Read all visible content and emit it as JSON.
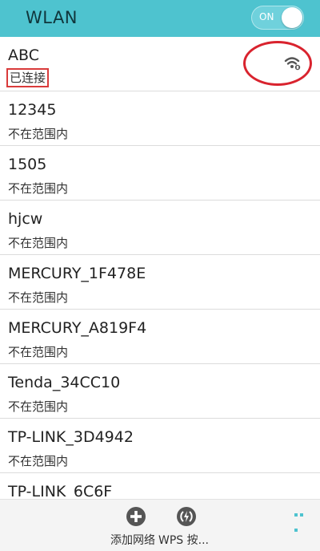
{
  "header": {
    "title": "WLAN",
    "toggle_label": "ON"
  },
  "networks": [
    {
      "ssid": "ABC",
      "status": "已连接"
    },
    {
      "ssid": "12345",
      "status": "不在范围内"
    },
    {
      "ssid": "1505",
      "status": "不在范围内"
    },
    {
      "ssid": "hjcw",
      "status": "不在范围内"
    },
    {
      "ssid": "MERCURY_1F478E",
      "status": "不在范围内"
    },
    {
      "ssid": "MERCURY_A819F4",
      "status": "不在范围内"
    },
    {
      "ssid": "Tenda_34CC10",
      "status": "不在范围内"
    },
    {
      "ssid": "TP-LINK_3D4942",
      "status": "不在范围内"
    },
    {
      "ssid": "TP-LINK_6C6F",
      "status": ""
    }
  ],
  "bottom": {
    "add_label": "添加网络",
    "wps_label": "WPS 按..."
  },
  "colors": {
    "accent": "#4ec3cf",
    "annotation": "#d9232e"
  }
}
